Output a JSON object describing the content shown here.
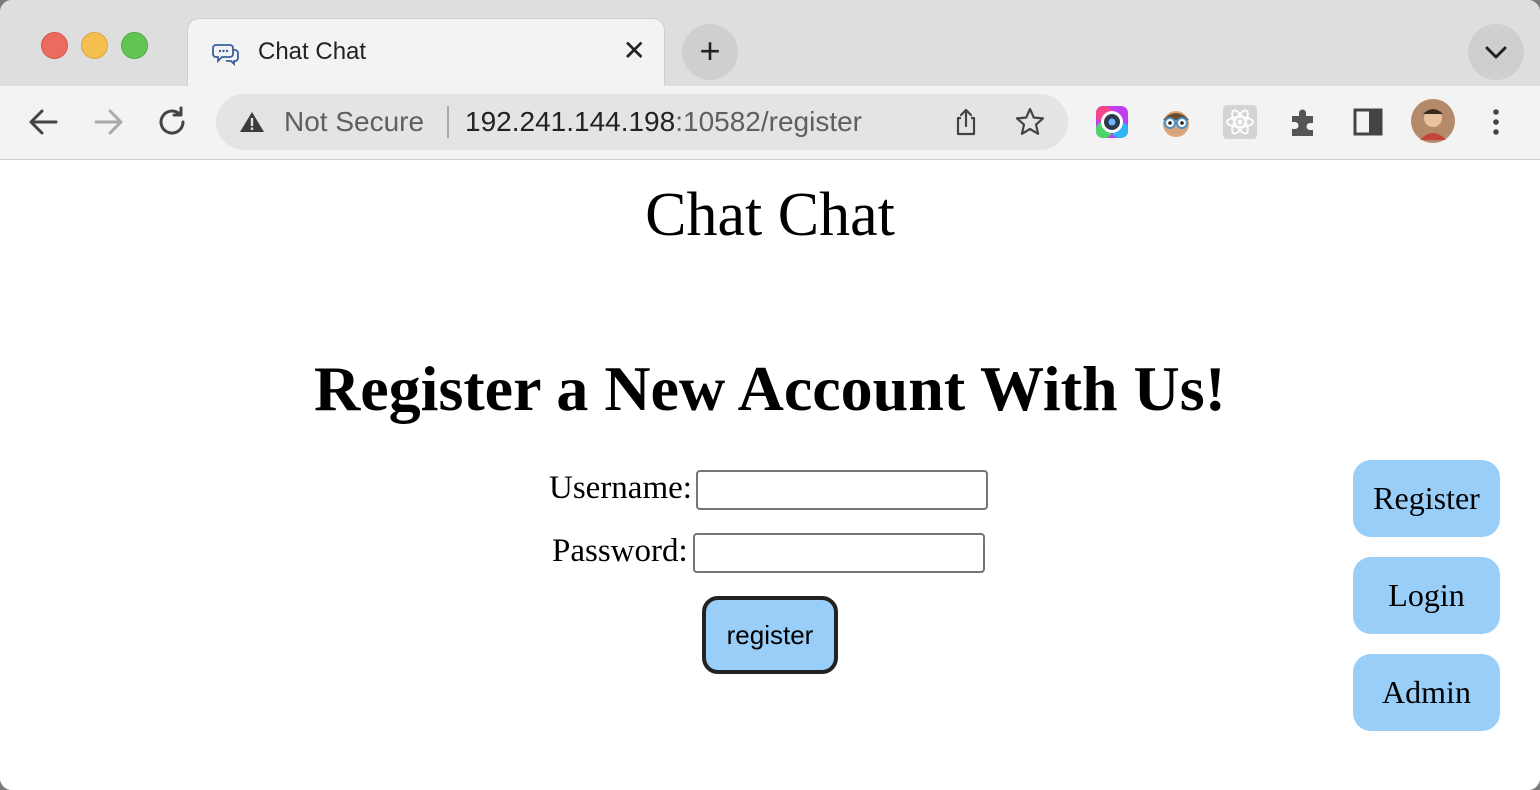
{
  "browser": {
    "tab_title": "Chat Chat",
    "tab_icon": "chat-bubbles-icon",
    "security_label": "Not Secure",
    "url_host": "192.241.144.198",
    "url_rest": ":10582/register",
    "extensions": [
      "color-picker-extension-icon",
      "glasses-face-extension-icon",
      "react-devtools-extension-icon",
      "puzzle-piece-icon",
      "side-panel-icon",
      "profile-avatar"
    ]
  },
  "page": {
    "site_title": "Chat Chat",
    "heading": "Register a New Account With Us!",
    "form": {
      "username_label": "Username:",
      "username_value": "",
      "password_label": "Password:",
      "password_value": "",
      "submit_label": "register"
    },
    "side_nav": [
      "Register",
      "Login",
      "Admin"
    ],
    "accent_color": "#99cef8"
  }
}
